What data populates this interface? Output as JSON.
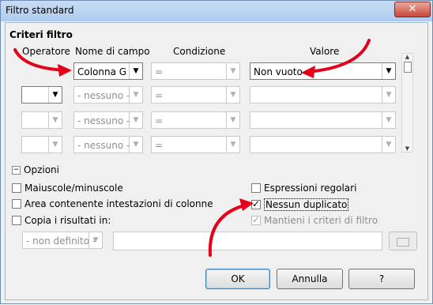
{
  "window": {
    "title": "Filtro standard",
    "close_label": "✕"
  },
  "criteria": {
    "section_title": "Criteri filtro",
    "headers": {
      "operator": "Operatore",
      "field": "Nome di campo",
      "condition": "Condizione",
      "value": "Valore"
    },
    "rows": [
      {
        "operator": "",
        "field": "Colonna G",
        "condition": "=",
        "value": "Non vuoto"
      },
      {
        "operator": "",
        "field": "- nessuno -",
        "condition": "=",
        "value": ""
      },
      {
        "operator": "",
        "field": "- nessuno -",
        "condition": "=",
        "value": ""
      },
      {
        "operator": "",
        "field": "- nessuno -",
        "condition": "=",
        "value": ""
      }
    ]
  },
  "options": {
    "section_title": "Opzioni",
    "case_sensitive": "Maiuscole/minuscole",
    "regex": "Espressioni regolari",
    "headers": "Area contenente intestazioni di colonne",
    "no_duplicates": "Nessun duplicato",
    "copy_results": "Copia i risultati in:",
    "keep_criteria": "Mantieni i criteri di filtro",
    "target_select": "- non definito -",
    "target_input": ""
  },
  "buttons": {
    "ok": "OK",
    "cancel": "Annulla",
    "help": "?"
  },
  "colors": {
    "arrow": "#e3001b"
  }
}
